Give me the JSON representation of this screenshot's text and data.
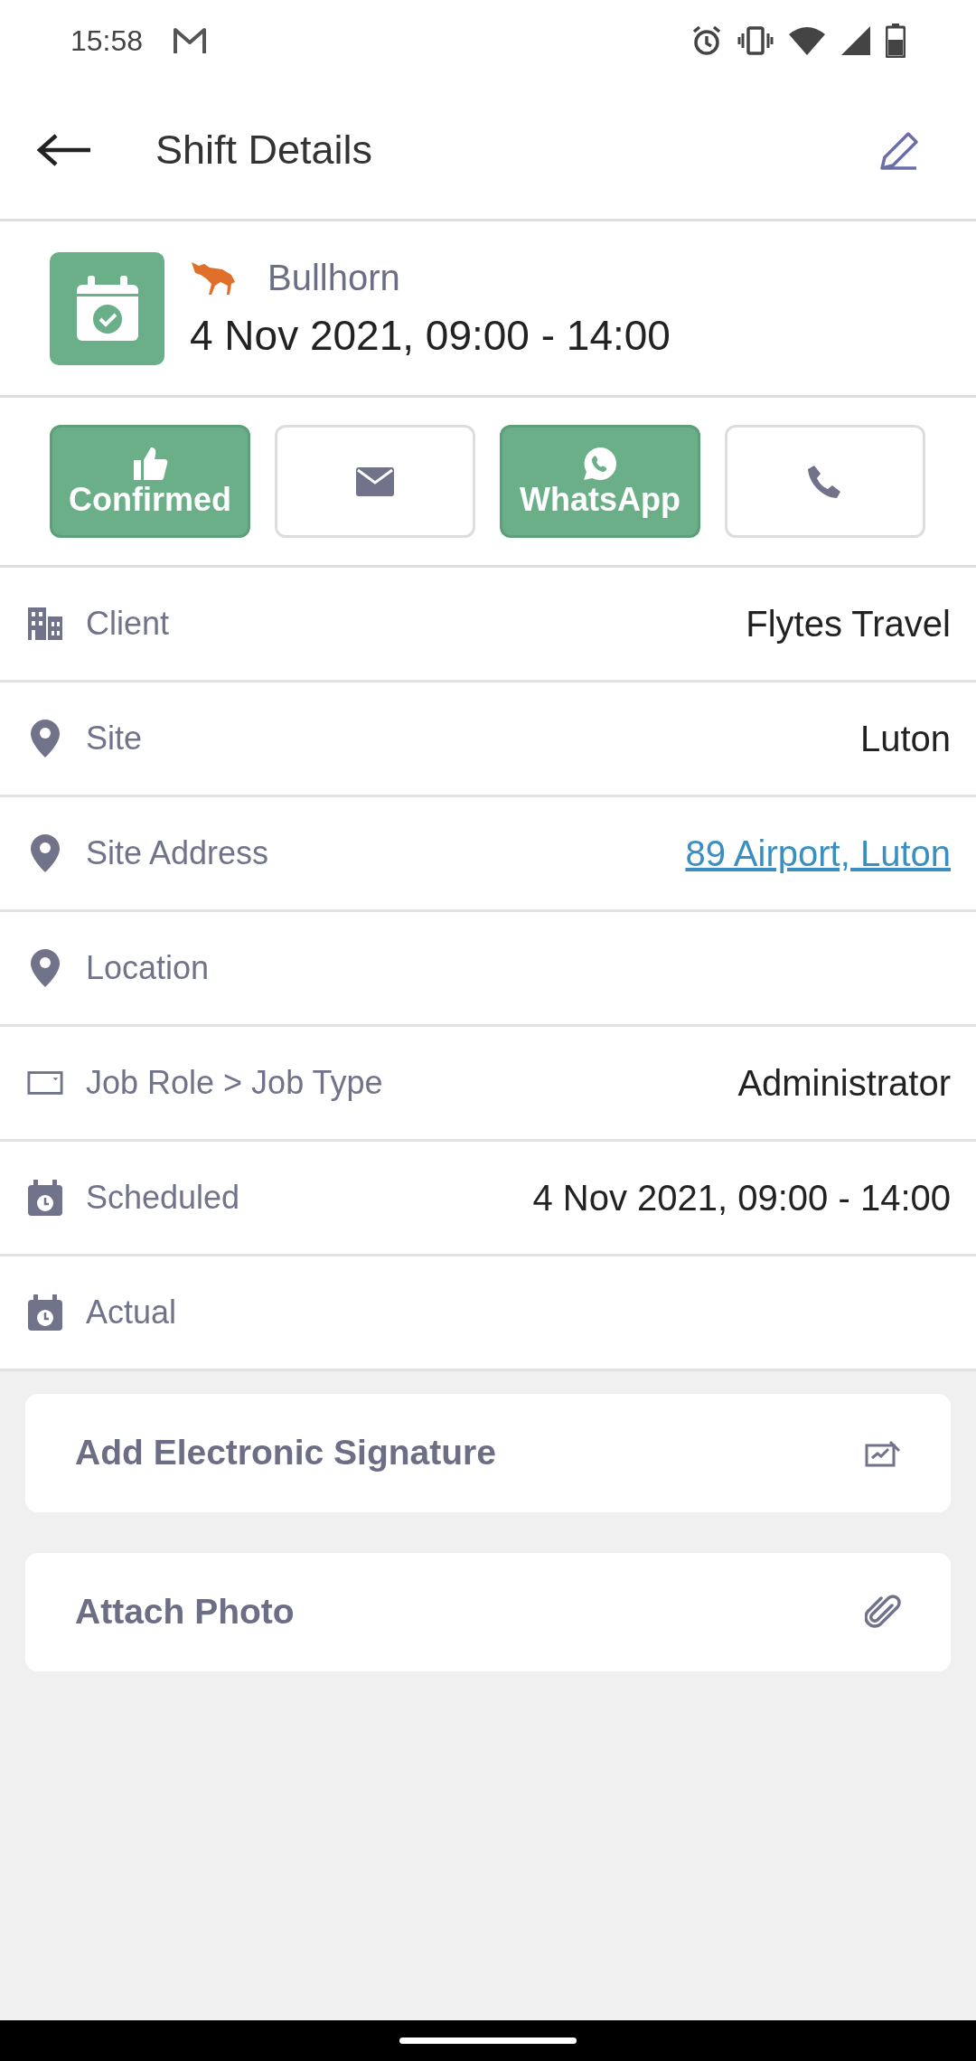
{
  "status_bar": {
    "time": "15:58"
  },
  "toolbar": {
    "title": "Shift Details"
  },
  "shift": {
    "agency": "Bullhorn",
    "when": "4 Nov 2021, 09:00 - 14:00"
  },
  "actions": [
    {
      "kind": "confirm",
      "label": "Confirmed",
      "on": true
    },
    {
      "kind": "email",
      "on": false
    },
    {
      "kind": "whatsapp",
      "label": "WhatsApp",
      "on": true
    },
    {
      "kind": "phone",
      "on": false
    }
  ],
  "details": [
    {
      "label": "Client",
      "value": "Flytes Travel"
    },
    {
      "label": "Site",
      "value": "Luton"
    },
    {
      "label": "Site Address",
      "value": "89 Airport, Luton",
      "kind": "link"
    },
    {
      "label": "Location"
    },
    {
      "label": "Job Role > Job Type",
      "value": "Administrator"
    },
    {
      "label": "Scheduled",
      "value": "4 Nov 2021, 09:00 - 14:00"
    },
    {
      "label": "Actual"
    }
  ],
  "cards": [
    {
      "label": "Add Electronic Signature",
      "kind": "signature"
    },
    {
      "label": "Attach Photo",
      "kind": "attach"
    }
  ]
}
